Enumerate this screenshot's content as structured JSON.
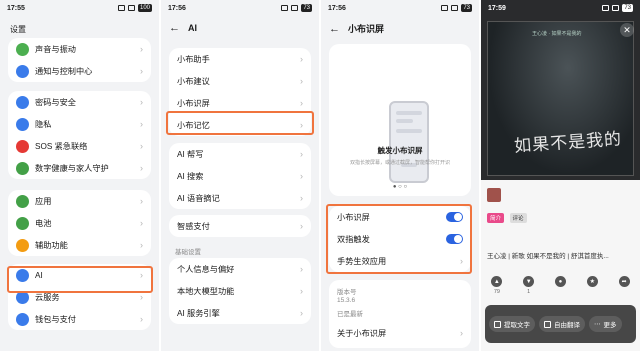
{
  "panel1": {
    "time": "17:55",
    "battery": "100",
    "title": "设置",
    "groups": [
      [
        {
          "label": "声音与振动",
          "icon": "sound-icon",
          "color": "#4caf50"
        },
        {
          "label": "通知与控制中心",
          "icon": "notification-icon",
          "color": "#3a7bea"
        }
      ],
      [
        {
          "label": "密码与安全",
          "icon": "lock-icon",
          "color": "#3a7bea"
        },
        {
          "label": "隐私",
          "icon": "privacy-icon",
          "color": "#3a7bea"
        },
        {
          "label": "SOS 紧急联络",
          "icon": "sos-icon",
          "color": "#e53935"
        },
        {
          "label": "数字健康与家人守护",
          "icon": "health-icon",
          "color": "#43a047"
        }
      ],
      [
        {
          "label": "应用",
          "icon": "apps-icon",
          "color": "#43a047"
        },
        {
          "label": "电池",
          "icon": "battery-icon",
          "color": "#43a047"
        },
        {
          "label": "辅助功能",
          "icon": "accessibility-icon",
          "color": "#f39c12"
        }
      ],
      [
        {
          "label": "AI",
          "icon": "ai-icon",
          "color": "#3a7bea"
        },
        {
          "label": "云服务",
          "icon": "cloud-icon",
          "color": "#3a7bea"
        },
        {
          "label": "钱包与支付",
          "icon": "wallet-icon",
          "color": "#3a7bea"
        }
      ]
    ]
  },
  "panel2": {
    "time": "17:56",
    "battery": "73",
    "title": "AI",
    "group1": [
      "小布助手",
      "小布建议",
      "小布识屏",
      "小布记忆"
    ],
    "group2": [
      "AI 帮写",
      "AI 搜索",
      "AI 语音摘记"
    ],
    "group3": [
      "智感支付"
    ],
    "section": "基础设置",
    "group4": [
      "个人信息与偏好",
      "本地大模型功能",
      "AI 服务引擎"
    ]
  },
  "panel3": {
    "time": "17:56",
    "battery": "73",
    "title": "小布识屏",
    "hero_title": "触发小布识屏",
    "hero_desc": "双指长按屏幕，或通过截屏，智能帮你打开识",
    "toggles": [
      "小布识屏",
      "双指触发"
    ],
    "gesture_row": "手势生效应用",
    "version_label": "版本号",
    "version_value": "15.3.6",
    "latest": "已是最新",
    "about": "关于小布识屏"
  },
  "panel4": {
    "time": "17:59",
    "battery": "73",
    "cover_title": "如果不是我的",
    "cover_sub": "王心凌 · 如果不是我的",
    "tags": [
      "简介",
      "评论"
    ],
    "post_text": "王心凌 | 新歌 如果不是我的 | 舒淇首度执...",
    "actions": [
      "79",
      "1",
      "",
      "",
      ""
    ],
    "overlay": {
      "extract": "提取文字",
      "translate": "自由翻译",
      "more": "更多"
    }
  }
}
